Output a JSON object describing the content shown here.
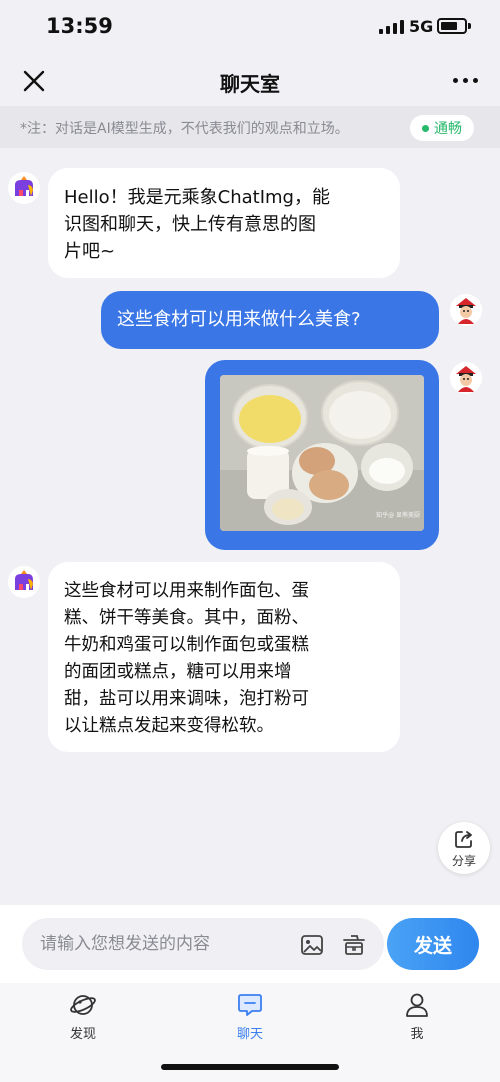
{
  "status_bar": {
    "time": "13:59",
    "network": "5G"
  },
  "nav": {
    "title": "聊天室"
  },
  "notice": {
    "text": "*注：对话是AI模型生成，不代表我们的观点和立场。",
    "status": "通畅",
    "status_color": "#27b86b"
  },
  "messages": [
    {
      "sender": "ai",
      "lines": [
        "Hello！我是元乘象ChatImg，能",
        "识图和聊天，快上传有意思的图",
        "片吧~"
      ]
    },
    {
      "sender": "user",
      "text": "这些食材可以用来做什么美食?"
    },
    {
      "sender": "user",
      "type": "image",
      "watermark": "知乎@ 显熊美厨"
    },
    {
      "sender": "ai",
      "lines": [
        "这些食材可以用来制作面包、蛋",
        "糕、饼干等美食。其中，面粉、",
        "牛奶和鸡蛋可以制作面包或蛋糕",
        "的面团或糕点，糖可以用来增",
        "甜，盐可以用来调味，泡打粉可",
        "以让糕点发起来变得松软。"
      ]
    }
  ],
  "share": {
    "label": "分享"
  },
  "input": {
    "placeholder": "请输入您想发送的内容",
    "send_label": "发送"
  },
  "tabbar": {
    "items": [
      {
        "label": "发现",
        "icon": "planet-icon"
      },
      {
        "label": "聊天",
        "icon": "chat-icon",
        "active": true
      },
      {
        "label": "我",
        "icon": "user-icon"
      }
    ]
  },
  "colors": {
    "accent": "#3a76e6",
    "background": "#f0f0f5"
  }
}
